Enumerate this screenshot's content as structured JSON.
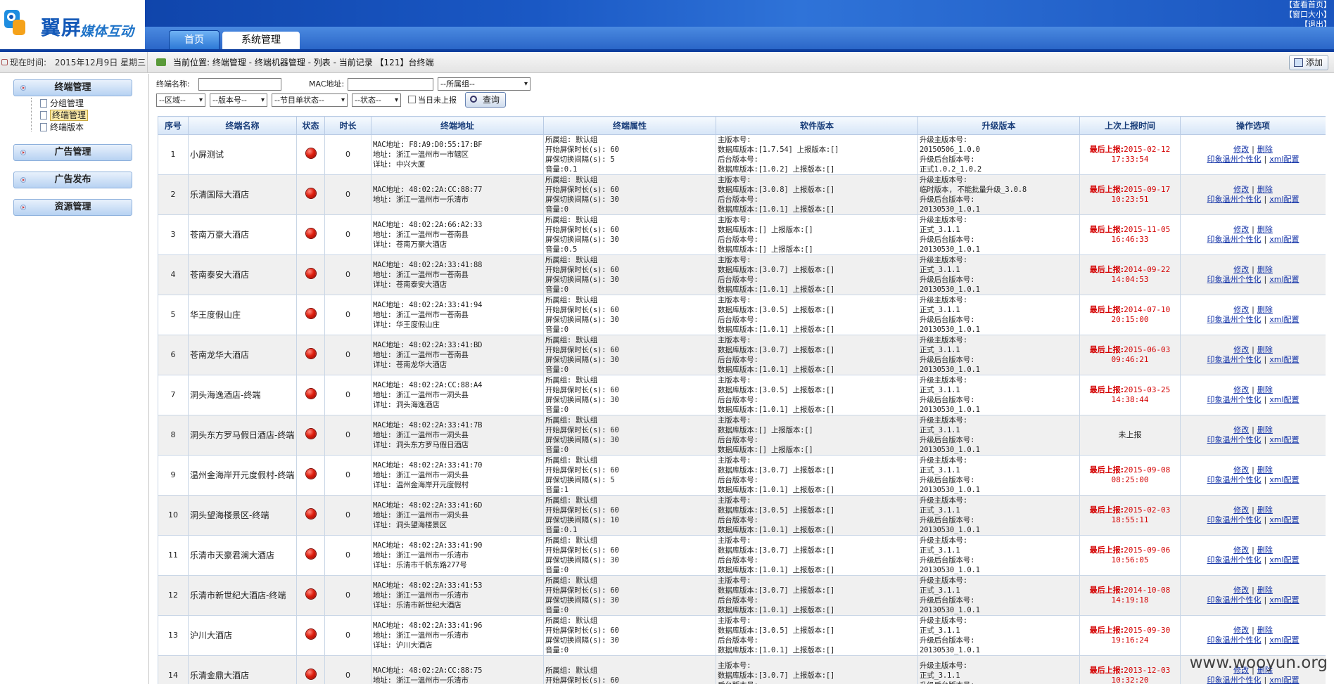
{
  "header": {
    "logo_text": "翼屏",
    "logo_sub": "媒体互动",
    "links": [
      "【查看首页】",
      "【窗口大小】",
      "【退出】"
    ],
    "tabs": [
      "首页",
      "系统管理"
    ]
  },
  "statusbar": {
    "time_label": "现在时间:",
    "time_value": "2015年12月9日 星期三",
    "breadcrumb": "当前位置: 终端管理 - 终端机器管理 - 列表 - 当前记录 【121】台终端",
    "add_label": "添加"
  },
  "sidebar": {
    "groups": [
      {
        "label": "终端管理",
        "children": [
          "分组管理",
          "终端管理",
          "终端版本"
        ],
        "selected_child": 1
      },
      {
        "label": "广告管理"
      },
      {
        "label": "广告发布"
      },
      {
        "label": "资源管理"
      }
    ]
  },
  "filters": {
    "name_label": "终端名称:",
    "name_value": "",
    "mac_label": "MAC地址:",
    "mac_value": "",
    "group_select": "--所属组--",
    "region_select": "--区域--",
    "version_select": "--版本号--",
    "program_select": "--节目单状态--",
    "state_select": "--状态--",
    "unreported_label": "当日未上报",
    "query_label": "查询"
  },
  "table": {
    "headers": [
      "序号",
      "终端名称",
      "状态",
      "时长",
      "终端地址",
      "终端属性",
      "软件版本",
      "升级版本",
      "上次上报时间",
      "操作选项"
    ],
    "ops": [
      "修改",
      "删除",
      "印象温州个性化",
      "xml配置"
    ],
    "rows": [
      {
        "no": "1",
        "name": "小屏测试",
        "dur": "0",
        "addr": [
          "MAC地址: F8:A9:D0:55:17:BF",
          "地址: 浙江一温州市一市辖区",
          "详址: 中兴大厦"
        ],
        "attr": [
          "所属组: 默认组",
          "开始屏保时长(s): 60",
          "屏保切换间隔(s): 5",
          "音量:0.1"
        ],
        "soft": [
          "主版本号:",
          "数据库版本:[1.7.54] 上报版本:[]",
          "后台版本号:",
          "数据库版本:[1.0.2] 上报版本:[]"
        ],
        "up": [
          "升级主版本号:",
          "20150506_1.0.0",
          "升级后台版本号:",
          "正式1.0.2_1.0.2"
        ],
        "report": [
          "最后上报:",
          "2015-02-12",
          "17:33:54"
        ]
      },
      {
        "no": "2",
        "name": "乐清国际大酒店",
        "dur": "0",
        "addr": [
          "MAC地址: 48:02:2A:CC:88:77",
          "地址: 浙江一温州市一乐清市",
          ""
        ],
        "attr": [
          "所属组: 默认组",
          "开始屏保时长(s): 60",
          "屏保切换间隔(s): 30",
          "音量:0"
        ],
        "soft": [
          "主版本号:",
          "数据库版本:[3.0.8] 上报版本:[]",
          "后台版本号:",
          "数据库版本:[1.0.1] 上报版本:[]"
        ],
        "up": [
          "升级主版本号:",
          "临时版本, 不能批量升级_3.0.8",
          "升级后台版本号:",
          "20130530_1.0.1"
        ],
        "report": [
          "最后上报:",
          "2015-09-17",
          "10:23:51"
        ]
      },
      {
        "no": "3",
        "name": "苍南万豪大酒店",
        "dur": "0",
        "addr": [
          "MAC地址: 48:02:2A:66:A2:33",
          "地址: 浙江一温州市一苍南县",
          "详址: 苍南万豪大酒店"
        ],
        "attr": [
          "所属组: 默认组",
          "开始屏保时长(s): 60",
          "屏保切换间隔(s): 30",
          "音量:0.5"
        ],
        "soft": [
          "主版本号:",
          "数据库版本:[] 上报版本:[]",
          "后台版本号:",
          "数据库版本:[] 上报版本:[]"
        ],
        "up": [
          "升级主版本号:",
          "正式_3.1.1",
          "升级后台版本号:",
          "20130530_1.0.1"
        ],
        "report": [
          "最后上报:",
          "2015-11-05",
          "16:46:33"
        ]
      },
      {
        "no": "4",
        "name": "苍南泰安大酒店",
        "dur": "0",
        "addr": [
          "MAC地址: 48:02:2A:33:41:88",
          "地址: 浙江一温州市一苍南县",
          "详址: 苍南泰安大酒店"
        ],
        "attr": [
          "所属组: 默认组",
          "开始屏保时长(s): 60",
          "屏保切换间隔(s): 30",
          "音量:0"
        ],
        "soft": [
          "主版本号:",
          "数据库版本:[3.0.7] 上报版本:[]",
          "后台版本号:",
          "数据库版本:[1.0.1] 上报版本:[]"
        ],
        "up": [
          "升级主版本号:",
          "正式_3.1.1",
          "升级后台版本号:",
          "20130530_1.0.1"
        ],
        "report": [
          "最后上报:",
          "2014-09-22",
          "14:04:53"
        ]
      },
      {
        "no": "5",
        "name": "华王度假山庄",
        "dur": "0",
        "addr": [
          "MAC地址: 48:02:2A:33:41:94",
          "地址: 浙江一温州市一苍南县",
          "详址: 华王度假山庄"
        ],
        "attr": [
          "所属组: 默认组",
          "开始屏保时长(s): 60",
          "屏保切换间隔(s): 30",
          "音量:0"
        ],
        "soft": [
          "主版本号:",
          "数据库版本:[3.0.5] 上报版本:[]",
          "后台版本号:",
          "数据库版本:[1.0.1] 上报版本:[]"
        ],
        "up": [
          "升级主版本号:",
          "正式_3.1.1",
          "升级后台版本号:",
          "20130530_1.0.1"
        ],
        "report": [
          "最后上报:",
          "2014-07-10",
          "20:15:00"
        ]
      },
      {
        "no": "6",
        "name": "苍南龙华大酒店",
        "dur": "0",
        "addr": [
          "MAC地址: 48:02:2A:33:41:BD",
          "地址: 浙江一温州市一苍南县",
          "详址: 苍南龙华大酒店"
        ],
        "attr": [
          "所属组: 默认组",
          "开始屏保时长(s): 60",
          "屏保切换间隔(s): 30",
          "音量:0"
        ],
        "soft": [
          "主版本号:",
          "数据库版本:[3.0.7] 上报版本:[]",
          "后台版本号:",
          "数据库版本:[1.0.1] 上报版本:[]"
        ],
        "up": [
          "升级主版本号:",
          "正式_3.1.1",
          "升级后台版本号:",
          "20130530_1.0.1"
        ],
        "report": [
          "最后上报:",
          "2015-06-03",
          "09:46:21"
        ]
      },
      {
        "no": "7",
        "name": "洞头海逸酒店-终端",
        "dur": "0",
        "addr": [
          "MAC地址: 48:02:2A:CC:88:A4",
          "地址: 浙江一温州市一洞头县",
          "详址: 洞头海逸酒店"
        ],
        "attr": [
          "所属组: 默认组",
          "开始屏保时长(s): 60",
          "屏保切换间隔(s): 30",
          "音量:0"
        ],
        "soft": [
          "主版本号:",
          "数据库版本:[3.0.5] 上报版本:[]",
          "后台版本号:",
          "数据库版本:[1.0.1] 上报版本:[]"
        ],
        "up": [
          "升级主版本号:",
          "正式_3.1.1",
          "升级后台版本号:",
          "20130530_1.0.1"
        ],
        "report": [
          "最后上报:",
          "2015-03-25",
          "14:38:44"
        ]
      },
      {
        "no": "8",
        "name": "洞头东方罗马假日酒店-终端",
        "dur": "0",
        "addr": [
          "MAC地址: 48:02:2A:33:41:7B",
          "地址: 浙江一温州市一洞头县",
          "详址: 洞头东方罗马假日酒店"
        ],
        "attr": [
          "所属组: 默认组",
          "开始屏保时长(s): 60",
          "屏保切换间隔(s): 30",
          "音量:0"
        ],
        "soft": [
          "主版本号:",
          "数据库版本:[] 上报版本:[]",
          "后台版本号:",
          "数据库版本:[] 上报版本:[]"
        ],
        "up": [
          "升级主版本号:",
          "正式_3.1.1",
          "升级后台版本号:",
          "20130530_1.0.1"
        ],
        "report": [
          "未上报"
        ]
      },
      {
        "no": "9",
        "name": "温州金海岸开元度假村-终端",
        "dur": "0",
        "addr": [
          "MAC地址: 48:02:2A:33:41:70",
          "地址: 浙江一温州市一洞头县",
          "详址: 温州金海岸开元度假村"
        ],
        "attr": [
          "所属组: 默认组",
          "开始屏保时长(s): 60",
          "屏保切换间隔(s): 5",
          "音量:1"
        ],
        "soft": [
          "主版本号:",
          "数据库版本:[3.0.7] 上报版本:[]",
          "后台版本号:",
          "数据库版本:[1.0.1] 上报版本:[]"
        ],
        "up": [
          "升级主版本号:",
          "正式_3.1.1",
          "升级后台版本号:",
          "20130530_1.0.1"
        ],
        "report": [
          "最后上报:",
          "2015-09-08",
          "08:25:00"
        ]
      },
      {
        "no": "10",
        "name": "洞头望海楼景区-终端",
        "dur": "0",
        "addr": [
          "MAC地址: 48:02:2A:33:41:6D",
          "地址: 浙江一温州市一洞头县",
          "详址: 洞头望海楼景区"
        ],
        "attr": [
          "所属组: 默认组",
          "开始屏保时长(s): 60",
          "屏保切换间隔(s): 10",
          "音量:0.1"
        ],
        "soft": [
          "主版本号:",
          "数据库版本:[3.0.5] 上报版本:[]",
          "后台版本号:",
          "数据库版本:[1.0.1] 上报版本:[]"
        ],
        "up": [
          "升级主版本号:",
          "正式_3.1.1",
          "升级后台版本号:",
          "20130530_1.0.1"
        ],
        "report": [
          "最后上报:",
          "2015-02-03",
          "18:55:11"
        ]
      },
      {
        "no": "11",
        "name": "乐清市天豪君澜大酒店",
        "dur": "0",
        "addr": [
          "MAC地址: 48:02:2A:33:41:90",
          "地址: 浙江一温州市一乐清市",
          "详址: 乐清市千帆东路277号"
        ],
        "attr": [
          "所属组: 默认组",
          "开始屏保时长(s): 60",
          "屏保切换间隔(s): 30",
          "音量:0"
        ],
        "soft": [
          "主版本号:",
          "数据库版本:[3.0.7] 上报版本:[]",
          "后台版本号:",
          "数据库版本:[1.0.1] 上报版本:[]"
        ],
        "up": [
          "升级主版本号:",
          "正式_3.1.1",
          "升级后台版本号:",
          "20130530_1.0.1"
        ],
        "report": [
          "最后上报:",
          "2015-09-06",
          "10:56:05"
        ]
      },
      {
        "no": "12",
        "name": "乐清市新世纪大酒店-终端",
        "dur": "0",
        "addr": [
          "MAC地址: 48:02:2A:33:41:53",
          "地址: 浙江一温州市一乐清市",
          "详址: 乐清市新世纪大酒店"
        ],
        "attr": [
          "所属组: 默认组",
          "开始屏保时长(s): 60",
          "屏保切换间隔(s): 30",
          "音量:0"
        ],
        "soft": [
          "主版本号:",
          "数据库版本:[3.0.7] 上报版本:[]",
          "后台版本号:",
          "数据库版本:[1.0.1] 上报版本:[]"
        ],
        "up": [
          "升级主版本号:",
          "正式_3.1.1",
          "升级后台版本号:",
          "20130530_1.0.1"
        ],
        "report": [
          "最后上报:",
          "2014-10-08",
          "14:19:18"
        ]
      },
      {
        "no": "13",
        "name": "沪川大酒店",
        "dur": "0",
        "addr": [
          "MAC地址: 48:02:2A:33:41:96",
          "地址: 浙江一温州市一乐清市",
          "详址: 沪川大酒店"
        ],
        "attr": [
          "所属组: 默认组",
          "开始屏保时长(s): 60",
          "屏保切换间隔(s): 30",
          "音量:0"
        ],
        "soft": [
          "主版本号:",
          "数据库版本:[3.0.5] 上报版本:[]",
          "后台版本号:",
          "数据库版本:[1.0.1] 上报版本:[]"
        ],
        "up": [
          "升级主版本号:",
          "正式_3.1.1",
          "升级后台版本号:",
          "20130530_1.0.1"
        ],
        "report": [
          "最后上报:",
          "2015-09-30",
          "19:16:24"
        ]
      },
      {
        "no": "14",
        "name": "乐清金鼎大酒店",
        "dur": "0",
        "addr": [
          "MAC地址: 48:02:2A:CC:88:75",
          "地址: 浙江一温州市一乐清市",
          ""
        ],
        "attr": [
          "所属组: 默认组",
          "开始屏保时长(s): 60",
          "",
          ""
        ],
        "soft": [
          "主版本号:",
          "数据库版本:[3.0.7] 上报版本:[]",
          "后台版本号:",
          ""
        ],
        "up": [
          "升级主版本号:",
          "正式_3.1.1",
          "升级后台版本号:",
          ""
        ],
        "report": [
          "最后上报:",
          "2013-12-03",
          "10:32:20"
        ]
      }
    ]
  },
  "watermark": "www.wooyun.org"
}
